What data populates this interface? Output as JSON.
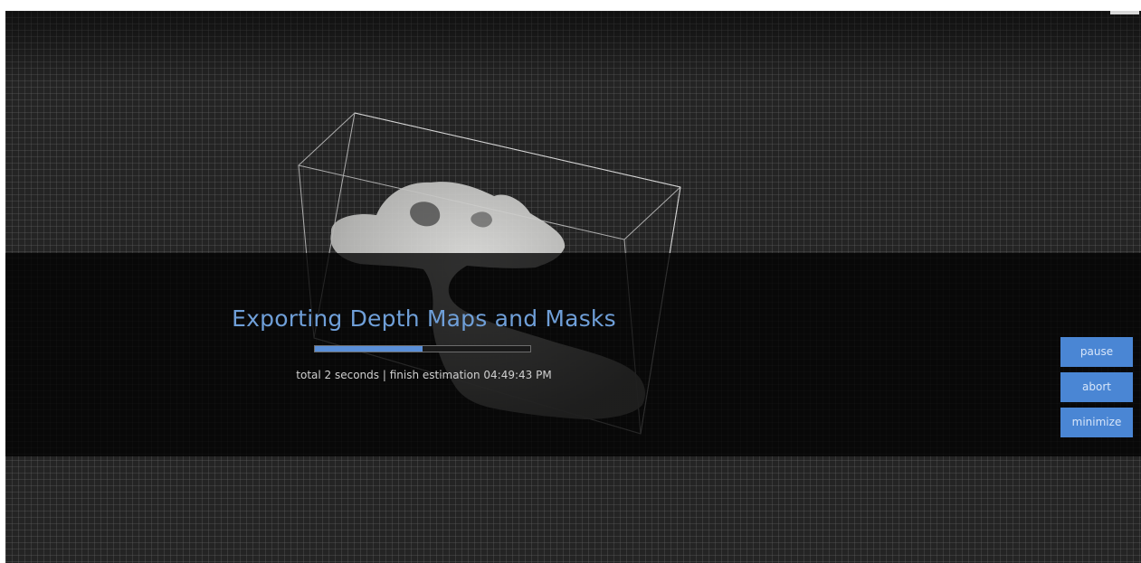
{
  "progress": {
    "title": "Exporting Depth Maps and Masks",
    "fraction": 0.5,
    "status": "total 2 seconds | finish estimation 04:49:43 PM"
  },
  "actions": {
    "pause_label": "pause",
    "abort_label": "abort",
    "minimize_label": "minimize"
  },
  "colors": {
    "accent": "#4a86d4",
    "title": "#6f9fd8",
    "overlay": "#000000"
  }
}
